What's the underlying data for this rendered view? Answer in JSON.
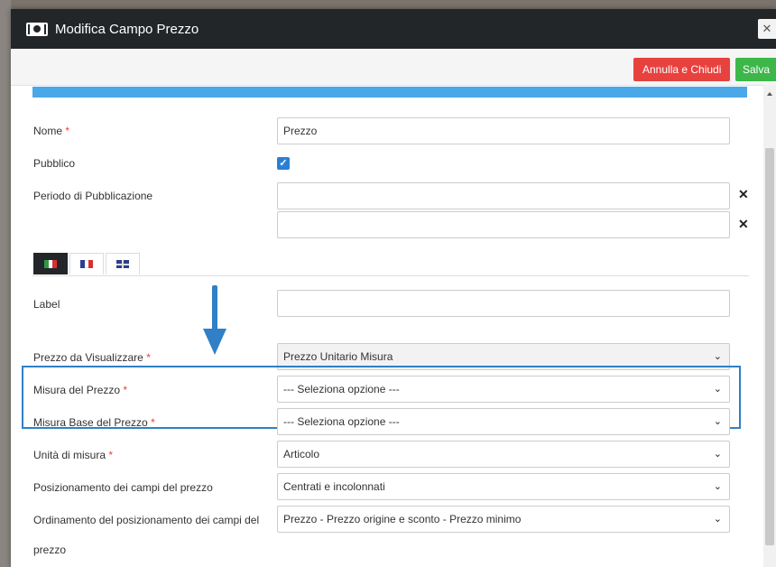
{
  "dialog": {
    "title": "Modifica Campo Prezzo",
    "close_icon": "✕"
  },
  "toolbar": {
    "cancel_label": "Annulla e Chiudi",
    "save_label": "Salva"
  },
  "form": {
    "name": {
      "label": "Nome",
      "required": "*",
      "value": "Prezzo"
    },
    "public": {
      "label": "Pubblico",
      "checked": true,
      "check_glyph": "✓"
    },
    "publication_period": {
      "label": "Periodo di Pubblicazione",
      "start": "",
      "end": "",
      "clear_glyph": "✕"
    },
    "language_tabs": [
      {
        "name": "italian",
        "flag_colors": [
          "#2e9a45",
          "#ffffff",
          "#d9302d"
        ],
        "active": true
      },
      {
        "name": "french",
        "flag_colors": [
          "#2a3f8f",
          "#ffffff",
          "#d9302d"
        ],
        "active": false
      },
      {
        "name": "english",
        "active": false
      }
    ],
    "label_field": {
      "label": "Label",
      "value": ""
    },
    "price_display": {
      "label": "Prezzo da Visualizzare",
      "required": "*",
      "value": "Prezzo Unitario Misura"
    },
    "price_measure": {
      "label": "Misura del Prezzo",
      "required": "*",
      "value": "--- Seleziona opzione ---"
    },
    "base_price_measure": {
      "label": "Misura Base del Prezzo",
      "required": "*",
      "value": "--- Seleziona opzione ---"
    },
    "unit": {
      "label": "Unità di misura",
      "required": "*",
      "value": "Articolo"
    },
    "fields_position": {
      "label": "Posizionamento dei campi del prezzo",
      "value": "Centrati e incolonnati"
    },
    "fields_order": {
      "label_line1": "Ordinamento del posizionamento dei campi del",
      "label_line2": "prezzo",
      "value": "Prezzo - Prezzo origine e sconto - Prezzo minimo"
    }
  },
  "chevron_glyph": "⌄",
  "colors": {
    "titlebar": "#222628",
    "cancel": "#e8423f",
    "save": "#3db74a",
    "accent_strip": "#4aa7e8",
    "highlight": "#2f80c6",
    "arrow": "#2f80c6"
  }
}
